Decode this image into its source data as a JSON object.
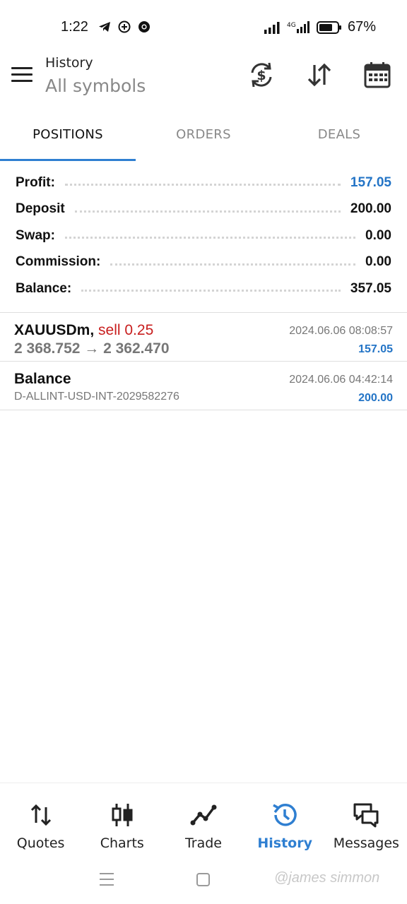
{
  "status_bar": {
    "time": "1:22",
    "battery": "67%",
    "network": "4G",
    "icons": [
      "telegram-icon",
      "circle-plus-icon",
      "chrome-icon",
      "signal-icon",
      "battery-icon"
    ]
  },
  "header": {
    "title": "History",
    "subtitle": "All symbols",
    "icons": [
      "menu-icon",
      "currency-refresh-icon",
      "sort-icon",
      "calendar-icon"
    ]
  },
  "tabs": [
    {
      "label": "POSITIONS",
      "active": true
    },
    {
      "label": "ORDERS",
      "active": false
    },
    {
      "label": "DEALS",
      "active": false
    }
  ],
  "summary": {
    "profit_label": "Profit:",
    "profit_value": "157.05",
    "deposit_label": "Deposit",
    "deposit_value": "200.00",
    "swap_label": "Swap:",
    "swap_value": "0.00",
    "commission_label": "Commission:",
    "commission_value": "0.00",
    "balance_label": "Balance:",
    "balance_value": "357.05"
  },
  "deals": [
    {
      "symbol": "XAUUSDm,",
      "action": "sell 0.25",
      "prices": "2 368.752 → 2 362.470",
      "time": "2024.06.06 08:08:57",
      "amount": "157.05"
    },
    {
      "symbol": "Balance",
      "comment": "D-ALLINT-USD-INT-2029582276",
      "time": "2024.06.06 04:42:14",
      "amount": "200.00"
    }
  ],
  "bottom_nav": [
    {
      "label": "Quotes",
      "icon": "quotes-icon",
      "active": false
    },
    {
      "label": "Charts",
      "icon": "charts-icon",
      "active": false
    },
    {
      "label": "Trade",
      "icon": "trade-icon",
      "active": false
    },
    {
      "label": "History",
      "icon": "history-icon",
      "active": true
    },
    {
      "label": "Messages",
      "icon": "messages-icon",
      "active": false
    }
  ],
  "watermark": "@james simmon",
  "colors": {
    "accent": "#2f7fd1",
    "profit_blue": "#2374c6",
    "sell_red": "#c81e1e"
  }
}
